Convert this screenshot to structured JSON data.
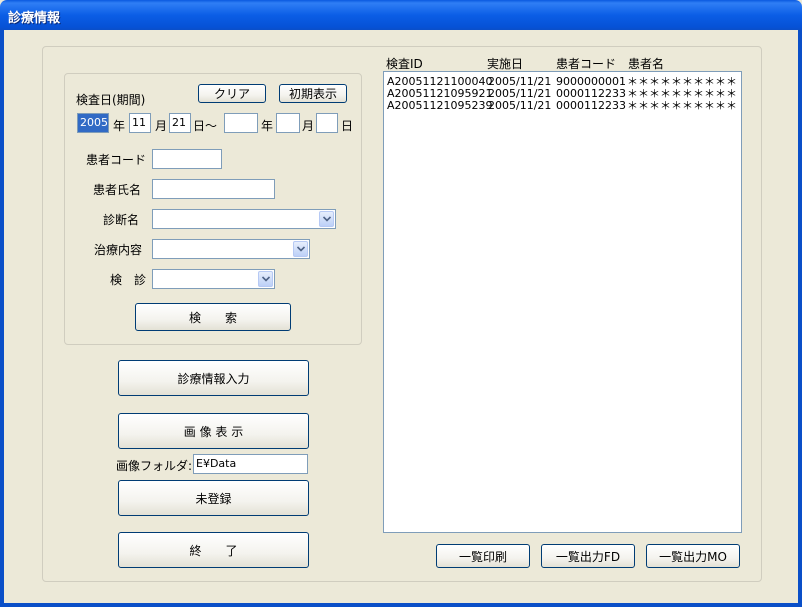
{
  "window": {
    "title": "診療情報"
  },
  "search": {
    "date_label": "検査日(期間)",
    "clear_button": "クリア",
    "reset_button": "初期表示",
    "from_year": "2005",
    "year_unit": "年",
    "from_month": "11",
    "month_unit": "月",
    "from_day": "21",
    "day_tilde": "日～",
    "to_year": "",
    "to_year_unit": "年",
    "to_month": "",
    "to_month_unit": "月",
    "to_day": "",
    "to_day_unit": "日",
    "patient_code_label": "患者コード",
    "patient_code_value": "",
    "patient_name_label": "患者氏名",
    "patient_name_value": "",
    "diagnosis_label": "診断名",
    "diagnosis_value": "",
    "treatment_label": "治療内容",
    "treatment_value": "",
    "checkup_label": "検　診",
    "checkup_value": "",
    "search_button": "検　　索"
  },
  "actions": {
    "medical_input_button": "診療情報入力",
    "image_display_button": "画 像 表 示",
    "image_folder_label": "画像フォルダ:",
    "image_folder_value": "E¥Data",
    "unregistered_button": "未登録",
    "exit_button": "終　　了"
  },
  "results": {
    "columns": [
      "検査ID",
      "実施日",
      "患者コード",
      "患者名"
    ],
    "rows": [
      {
        "id": "A20051121100040",
        "date": "2005/11/21",
        "code": "9000000001",
        "name": "＊＊＊＊＊＊＊＊＊＊"
      },
      {
        "id": "A20051121095921",
        "date": "2005/11/21",
        "code": "0000112233",
        "name": "＊＊＊＊＊＊＊＊＊＊"
      },
      {
        "id": "A20051121095239",
        "date": "2005/11/21",
        "code": "0000112233",
        "name": "＊＊＊＊＊＊＊＊＊＊"
      }
    ]
  },
  "footer": {
    "print_list_button": "一覧印刷",
    "export_fd_button": "一覧出力FD",
    "export_mo_button": "一覧出力MO"
  }
}
